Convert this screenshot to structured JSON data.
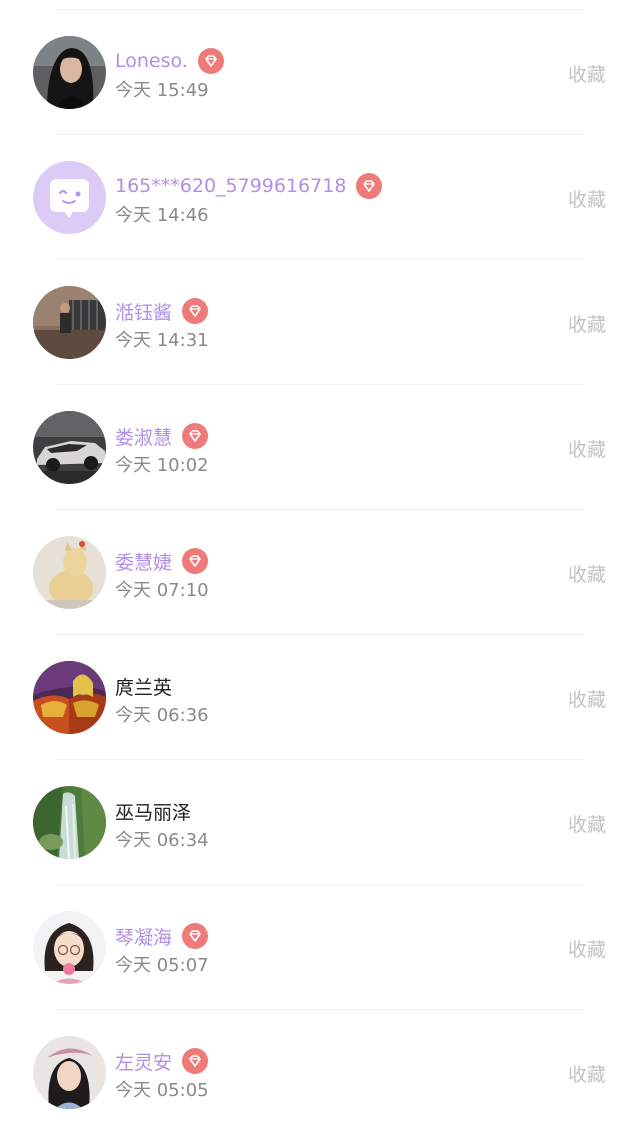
{
  "favorite_label": "收藏",
  "colors": {
    "vip_name": "#b28fe6",
    "regular_name": "#222222",
    "time": "#8a8a8a",
    "favorite": "#c4c4c4",
    "badge": "#ee7a7a",
    "divider": "#efefef"
  },
  "users": [
    {
      "name": "Loneso.",
      "time": "今天 15:49",
      "vip": true,
      "avatar": "avatar-photo-girl-dark-hair"
    },
    {
      "name": "165***620_5799616718",
      "time": "今天 14:46",
      "vip": true,
      "avatar": "avatar-default-chat-bubble"
    },
    {
      "name": "湉钰酱",
      "time": "今天 14:31",
      "vip": true,
      "avatar": "avatar-photo-balcony"
    },
    {
      "name": "娄淑慧",
      "time": "今天 10:02",
      "vip": true,
      "avatar": "avatar-photo-sports-car"
    },
    {
      "name": "委慧婕",
      "time": "今天 07:10",
      "vip": true,
      "avatar": "avatar-photo-cat-figurine"
    },
    {
      "name": "庹兰英",
      "time": "今天 06:36",
      "vip": false,
      "avatar": "avatar-game-character"
    },
    {
      "name": "巫马丽泽",
      "time": "今天 06:34",
      "vip": false,
      "avatar": "avatar-photo-waterfall"
    },
    {
      "name": "琴凝海",
      "time": "今天 05:07",
      "vip": true,
      "avatar": "avatar-cartoon-girl-glasses"
    },
    {
      "name": "左灵安",
      "time": "今天 05:05",
      "vip": true,
      "avatar": "avatar-photo-girl-beret"
    }
  ]
}
